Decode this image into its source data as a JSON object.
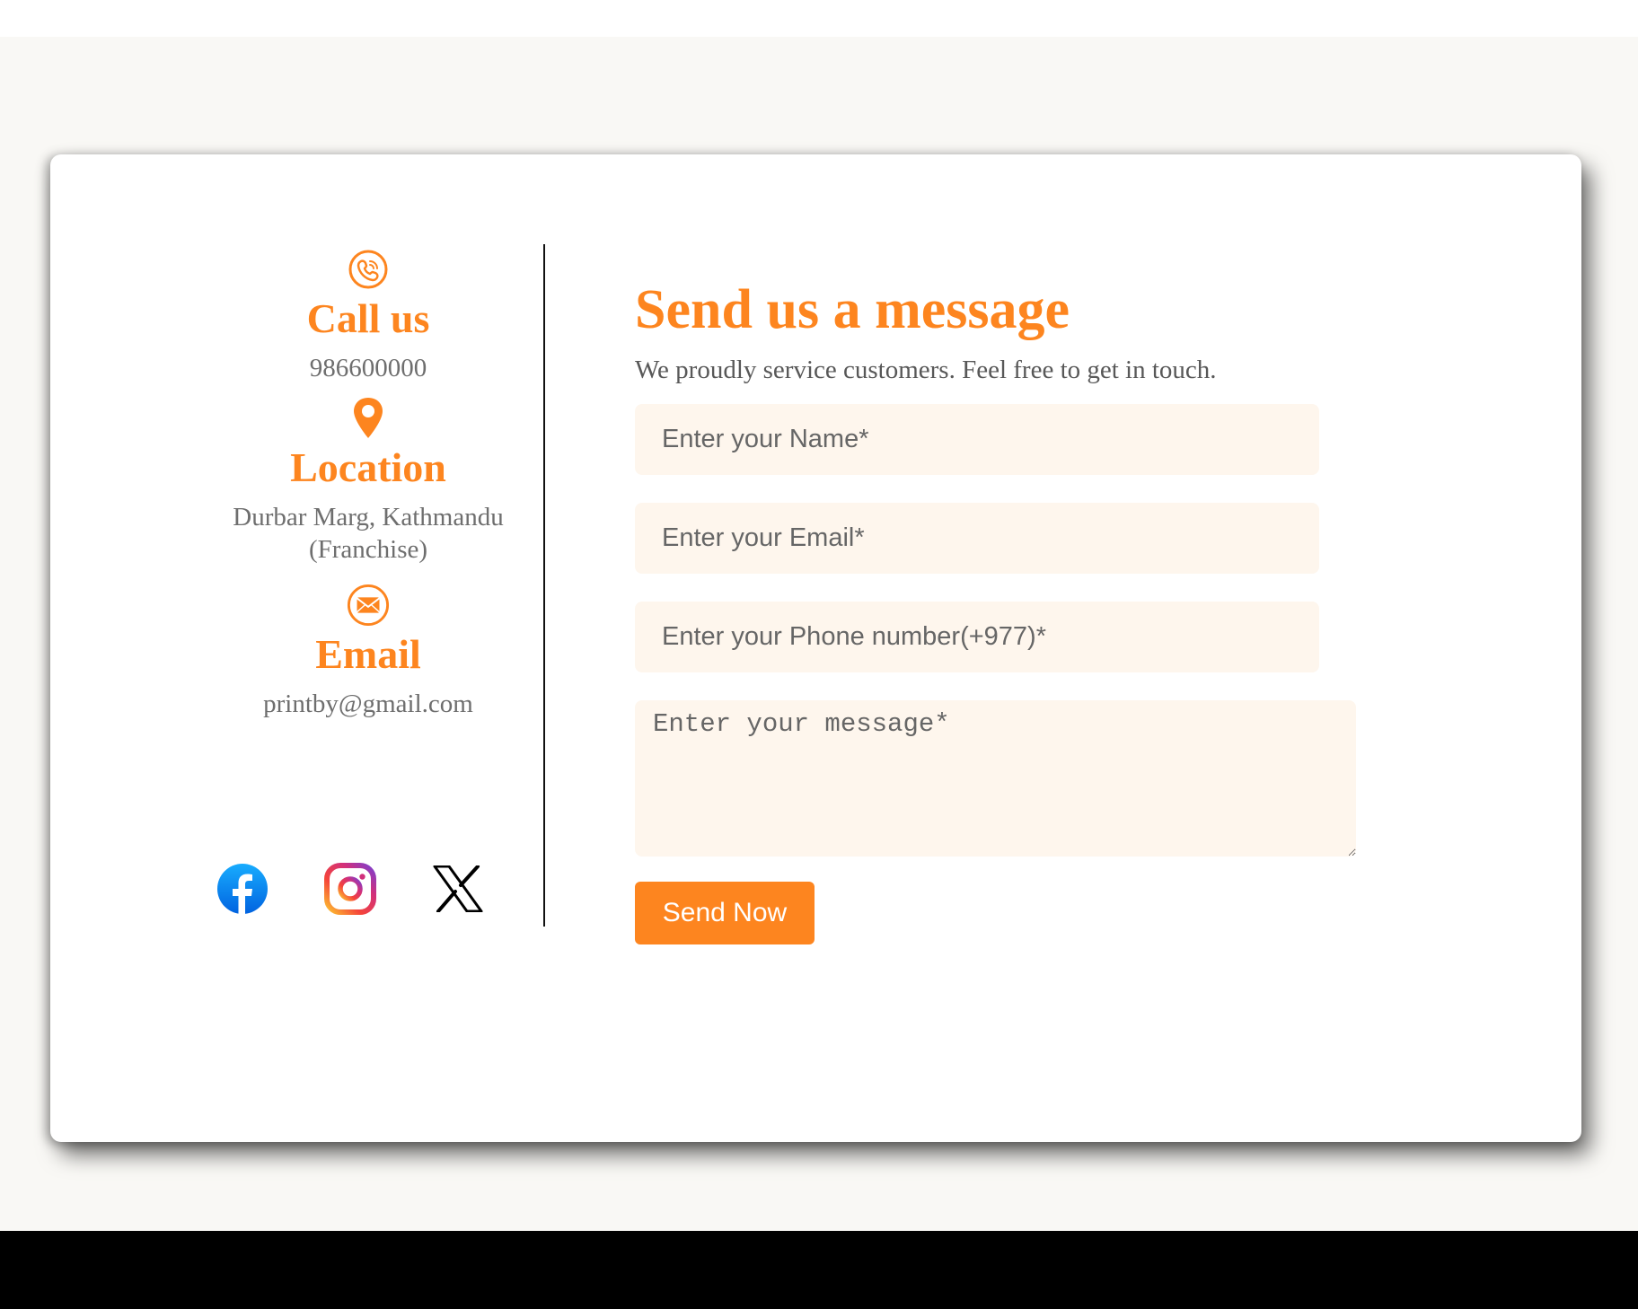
{
  "colors": {
    "accent": "#fd851f",
    "field_background": "#fef6ed",
    "page_background": "#f9f8f5",
    "footer": "#000000"
  },
  "contact_info": {
    "call": {
      "icon": "phone-icon",
      "title": "Call us",
      "value": "986600000"
    },
    "location": {
      "icon": "location-pin-icon",
      "title": "Location",
      "value": "Durbar Marg, Kathmandu (Franchise)"
    },
    "email": {
      "icon": "envelope-icon",
      "title": "Email",
      "value": "printby@gmail.com"
    }
  },
  "socials": [
    {
      "icon": "facebook-icon"
    },
    {
      "icon": "instagram-icon"
    },
    {
      "icon": "x-twitter-icon"
    }
  ],
  "form": {
    "title": "Send us a message",
    "subtitle": "We proudly service customers. Feel free to get in touch.",
    "name_placeholder": "Enter your Name*",
    "email_placeholder": "Enter your Email*",
    "phone_placeholder": "Enter your Phone number(+977)*",
    "message_placeholder": "Enter your message*",
    "submit_label": "Send Now"
  }
}
